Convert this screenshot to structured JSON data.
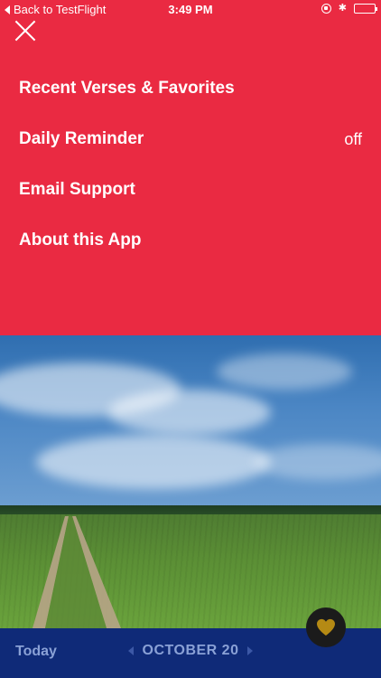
{
  "status_bar": {
    "back_label": "Back to TestFlight",
    "time": "3:49 PM"
  },
  "menu": {
    "items": [
      {
        "label": "Recent Verses & Favorites",
        "value": ""
      },
      {
        "label": "Daily Reminder",
        "value": "off"
      },
      {
        "label": "Email Support",
        "value": ""
      },
      {
        "label": "About this App",
        "value": ""
      }
    ]
  },
  "bottom_bar": {
    "today_label": "Today",
    "date_label": "OCTOBER 20"
  },
  "colors": {
    "menu_background": "#ea2a42",
    "bottom_bar": "#0f2a78",
    "heart": "#b58a14"
  },
  "icons": [
    "back-chevron-icon",
    "lock-rotation-icon",
    "bluetooth-icon",
    "battery-icon",
    "close-icon",
    "prev-date-icon",
    "next-date-icon",
    "heart-icon"
  ]
}
